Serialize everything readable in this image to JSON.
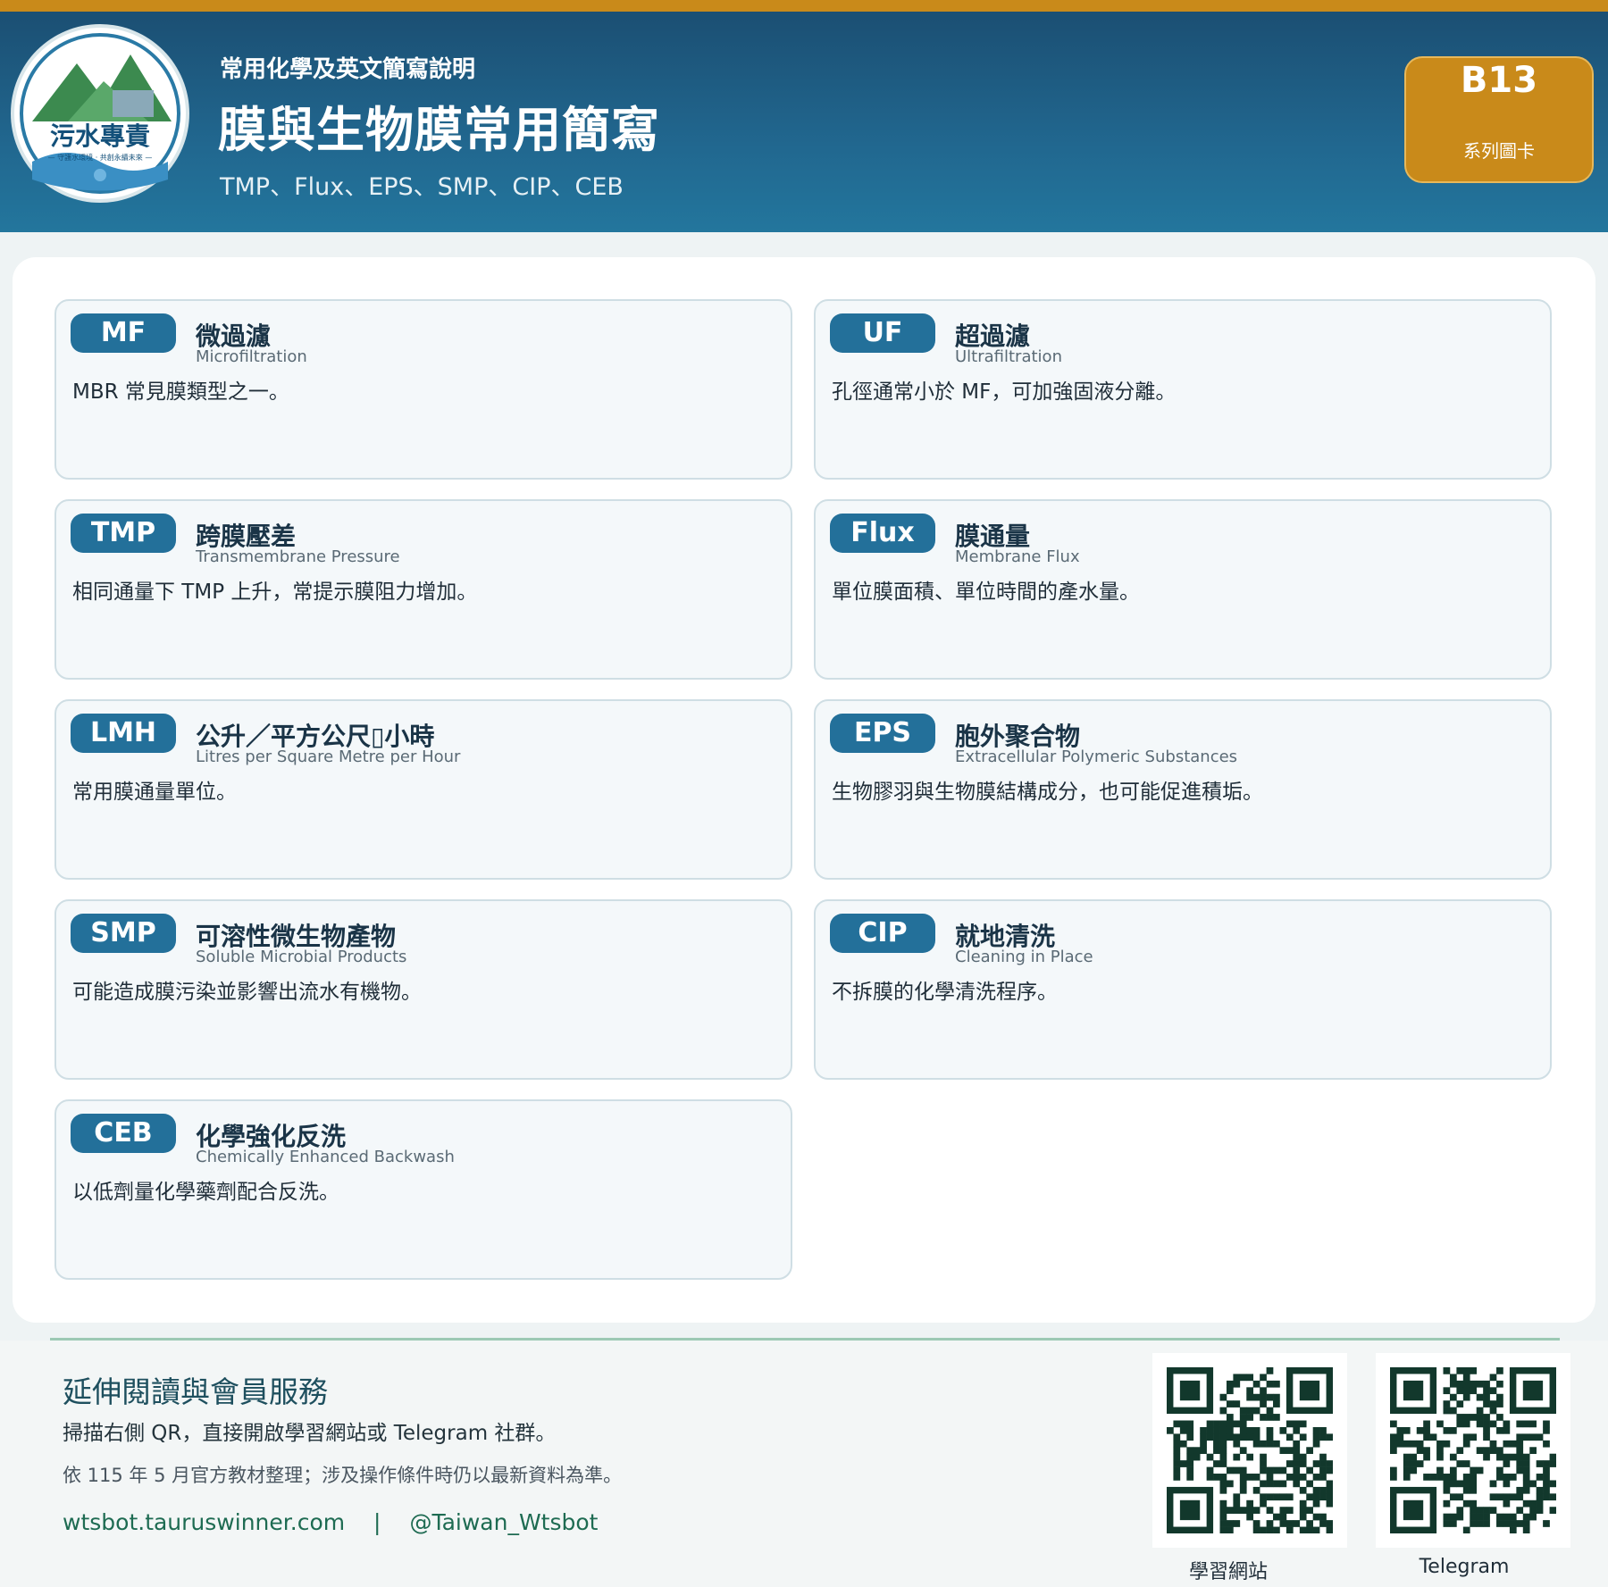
{
  "header": {
    "logo_text": "污水專責",
    "logo_sub": "— 守護水環境 · 共創永續未來 —",
    "subtitle": "常用化學及英文簡寫說明",
    "title": "膜與生物膜常用簡寫",
    "list": "TMP、Flux、EPS、SMP、CIP、CEB",
    "badge_code": "B13",
    "badge_label": "系列圖卡"
  },
  "cards": [
    {
      "abbr": "MF",
      "zh": "微過濾",
      "en": "Microfiltration",
      "desc": "MBR 常見膜類型之一。"
    },
    {
      "abbr": "UF",
      "zh": "超過濾",
      "en": "Ultrafiltration",
      "desc": "孔徑通常小於 MF，可加強固液分離。"
    },
    {
      "abbr": "TMP",
      "zh": "跨膜壓差",
      "en": "Transmembrane Pressure",
      "desc": "相同通量下 TMP 上升，常提示膜阻力增加。"
    },
    {
      "abbr": "Flux",
      "zh": "膜通量",
      "en": "Membrane Flux",
      "desc": "單位膜面積、單位時間的產水量。"
    },
    {
      "abbr": "LMH",
      "zh": "公升／平方公尺▯小時",
      "en": "Litres per Square Metre per Hour",
      "desc": "常用膜通量單位。"
    },
    {
      "abbr": "EPS",
      "zh": "胞外聚合物",
      "en": "Extracellular Polymeric Substances",
      "desc": "生物膠羽與生物膜結構成分，也可能促進積垢。"
    },
    {
      "abbr": "SMP",
      "zh": "可溶性微生物產物",
      "en": "Soluble Microbial Products",
      "desc": "可能造成膜污染並影響出流水有機物。"
    },
    {
      "abbr": "CIP",
      "zh": "就地清洗",
      "en": "Cleaning in Place",
      "desc": "不拆膜的化學清洗程序。"
    },
    {
      "abbr": "CEB",
      "zh": "化學強化反洗",
      "en": "Chemically Enhanced Backwash",
      "desc": "以低劑量化學藥劑配合反洗。"
    }
  ],
  "footer": {
    "title": "延伸閱讀與會員服務",
    "line1": "掃描右側 QR，直接開啟學習網站或 Telegram 社群。",
    "line2": "依 115 年 5 月官方教材整理；涉及操作條件時仍以最新資料為準。",
    "link_site": "wtsbot.tauruswinner.com",
    "link_sep": "|",
    "link_tg": "@Taiwan_Wtsbot",
    "qr1_label": "學習網站",
    "qr2_label": "Telegram"
  },
  "colors": {
    "accent_gold": "#c98a1a",
    "header_blue": "#1b4f73",
    "pill_blue": "#23709a",
    "footer_green": "#1e6b52"
  },
  "icons": [
    "logo-emblem",
    "qr-code"
  ]
}
